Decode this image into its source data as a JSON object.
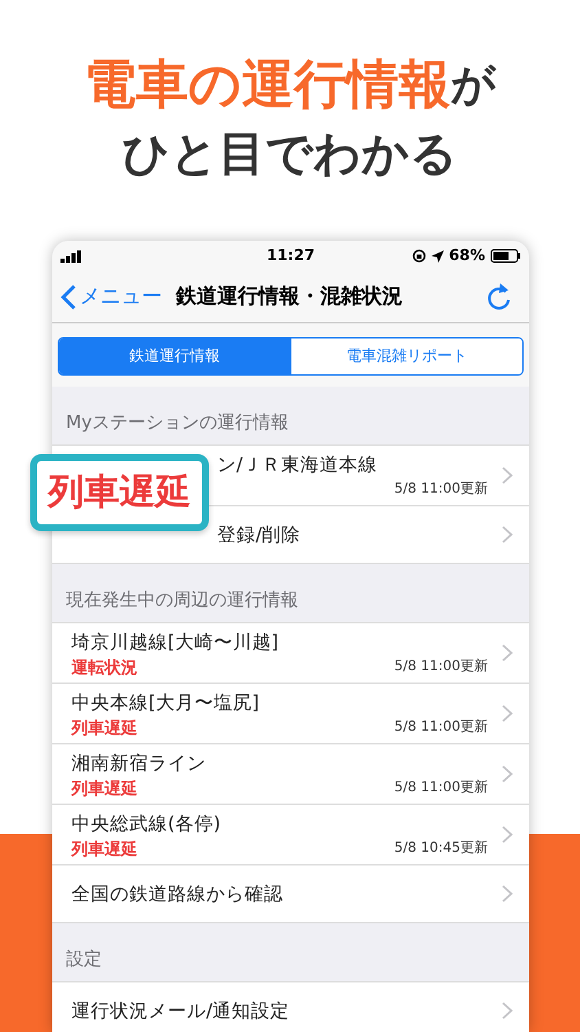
{
  "headline": [
    {
      "text": "電車の運行情報",
      "accent": true
    },
    {
      "text": "が",
      "accent": false
    }
  ],
  "subheadline": "ひと目でわかる",
  "status_bar": {
    "time": "11:27",
    "battery": "68%"
  },
  "nav": {
    "back": "メニュー",
    "title": "鉄道運行情報・混雑状況"
  },
  "segments": [
    {
      "label": "鉄道運行情報",
      "selected": true
    },
    {
      "label": "電車混雑リポート",
      "selected": false
    }
  ],
  "sections": [
    {
      "header": "Myステーションの運行情報",
      "rows": [
        {
          "title": "ン/ＪＲ東海道本線",
          "updated": "5/8 11:00更新",
          "covered": true
        },
        {
          "title": "登録/削除",
          "covered": true
        }
      ]
    },
    {
      "header": "現在発生中の周辺の運行情報",
      "rows": [
        {
          "title": "埼京川越線[大崎〜川越]",
          "status": "運転状況",
          "updated": "5/8 11:00更新",
          "covered": false
        },
        {
          "title": "中央本線[大月〜塩尻]",
          "status": "列車遅延",
          "updated": "5/8 11:00更新",
          "covered": false
        },
        {
          "title": "湘南新宿ライン",
          "status": "列車遅延",
          "updated": "5/8 11:00更新",
          "covered": false
        },
        {
          "title": "中央総武線(各停)",
          "status": "列車遅延",
          "updated": "5/8 10:45更新",
          "covered": false
        },
        {
          "title": "全国の鉄道路線から確認",
          "covered": false
        }
      ]
    },
    {
      "header": "設定",
      "rows": [
        {
          "title": "運行状況メール/通知設定",
          "covered": false
        }
      ]
    }
  ],
  "callout": "列車遅延"
}
